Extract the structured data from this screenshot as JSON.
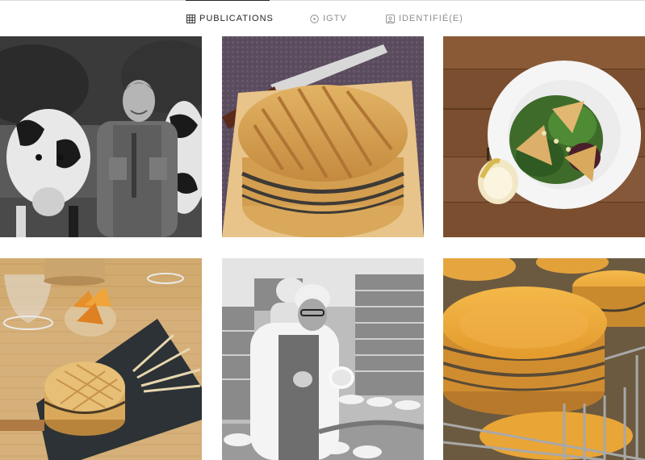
{
  "tabs": [
    {
      "label": "PUBLICATIONS",
      "icon": "grid-icon",
      "active": true
    },
    {
      "label": "IGTV",
      "icon": "igtv-icon",
      "active": false
    },
    {
      "label": "IDENTIFIÉ(E)",
      "icon": "tagged-icon",
      "active": false
    }
  ],
  "posts": [
    {
      "subject": "farmer-with-cows"
    },
    {
      "subject": "cheese-on-board-with-knife"
    },
    {
      "subject": "salad-plate-with-pear"
    },
    {
      "subject": "cheese-platter-with-wine"
    },
    {
      "subject": "cheese-factory-worker"
    },
    {
      "subject": "cheese-wheels-on-rack"
    }
  ],
  "colors": {
    "active_text": "#262626",
    "inactive_text": "#8e8e8e",
    "divider": "#dbdbdb"
  }
}
